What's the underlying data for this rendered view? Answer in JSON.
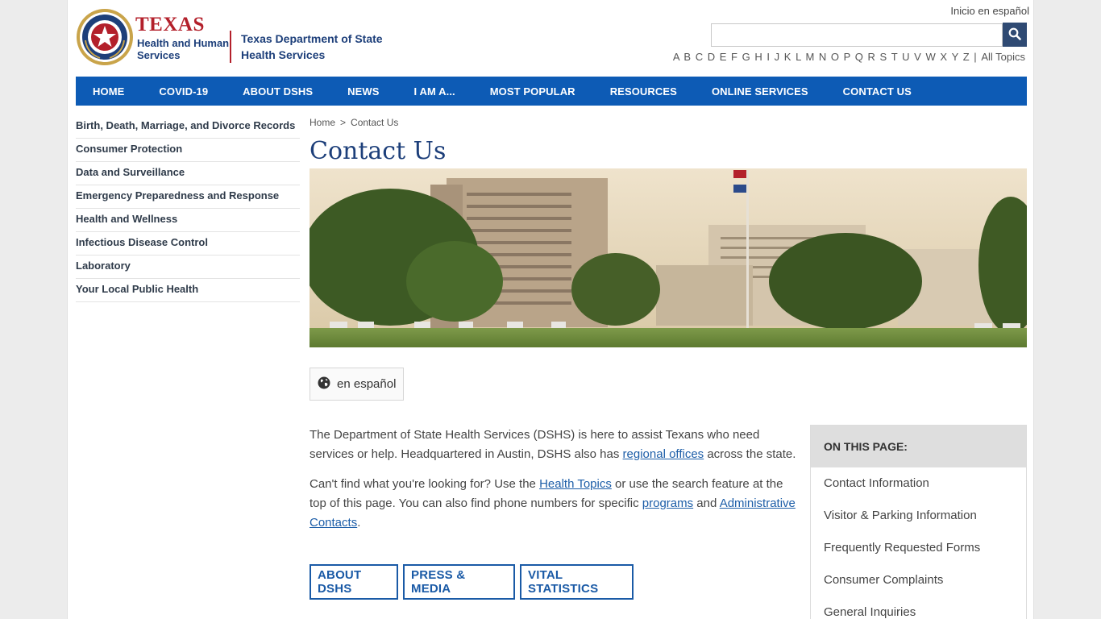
{
  "header": {
    "logo_texas": "TEXAS",
    "logo_hhs": "Health and Human Services",
    "logo_dshs": "Texas Department of State Health Services",
    "spanish_link": "Inicio en español",
    "search_placeholder": "",
    "az_letters": [
      "A",
      "B",
      "C",
      "D",
      "E",
      "F",
      "G",
      "H",
      "I",
      "J",
      "K",
      "L",
      "M",
      "N",
      "O",
      "P",
      "Q",
      "R",
      "S",
      "T",
      "U",
      "V",
      "W",
      "X",
      "Y",
      "Z"
    ],
    "az_separator": "|",
    "az_all": "All Topics"
  },
  "nav": {
    "items": [
      "HOME",
      "COVID-19",
      "ABOUT DSHS",
      "NEWS",
      "I AM A...",
      "MOST POPULAR",
      "RESOURCES",
      "ONLINE SERVICES",
      "CONTACT US"
    ]
  },
  "sidebar": {
    "items": [
      "Birth, Death, Marriage, and Divorce Records",
      "Consumer Protection",
      "Data and Surveillance",
      "Emergency Preparedness and Response",
      "Health and Wellness",
      "Infectious Disease Control",
      "Laboratory",
      "Your Local Public Health"
    ]
  },
  "breadcrumb": {
    "home": "Home",
    "sep": ">",
    "current": "Contact Us"
  },
  "main": {
    "title": "Contact Us",
    "lang_button": "en español",
    "para1_a": "The Department of State Health Services (DSHS) is here to assist Texans who need services or help. Headquartered in Austin, DSHS also has ",
    "para1_link": "regional offices",
    "para1_b": " across the state.",
    "para2_a": "Can't find what you're looking for? Use the ",
    "para2_link1": "Health Topics",
    "para2_b": " or use the search feature at the top of this page. You can also find phone numbers for specific ",
    "para2_link2": "programs",
    "para2_c": " and ",
    "para2_link3": "Administrative Contacts",
    "para2_d": ".",
    "buttons": [
      "ABOUT DSHS",
      "PRESS & MEDIA",
      "VITAL STATISTICS"
    ]
  },
  "on_this_page": {
    "heading": "ON THIS PAGE:",
    "items": [
      "Contact Information",
      "Visitor & Parking Information",
      "Frequently Requested Forms",
      "Consumer Complaints",
      "General Inquiries"
    ]
  },
  "colors": {
    "nav_blue": "#0d5bb5",
    "title_blue": "#1d3f7a",
    "texas_red": "#b3202b",
    "link_blue": "#1d5ea8"
  }
}
